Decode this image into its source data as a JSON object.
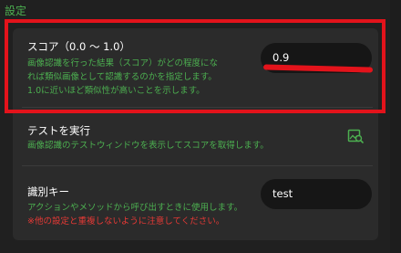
{
  "section": {
    "title": "設定"
  },
  "score": {
    "label": "スコア（0.0 〜 1.0）",
    "desc_lines": [
      "画像認識を行った結果（スコア）がどの程度にな",
      "れば類似画像として認識するのかを指定します。",
      "1.0に近いほど類似性が高いことを示します。"
    ],
    "value": "0.9"
  },
  "test": {
    "label": "テストを実行",
    "desc": "画像認識のテストウィンドウを表示してスコアを取得します。",
    "icon": "image-search-icon"
  },
  "key": {
    "label": "識別キー",
    "desc": "アクションやメソッドから呼び出すときに使用します。",
    "warning": "※他の設定と重複しないように注意してください。",
    "value": "test"
  },
  "colors": {
    "accent_green": "#4caf50",
    "warning_red": "#e53935",
    "highlight_red": "#e3131b",
    "panel_bg": "#2b2b2b",
    "input_bg": "#161616"
  }
}
